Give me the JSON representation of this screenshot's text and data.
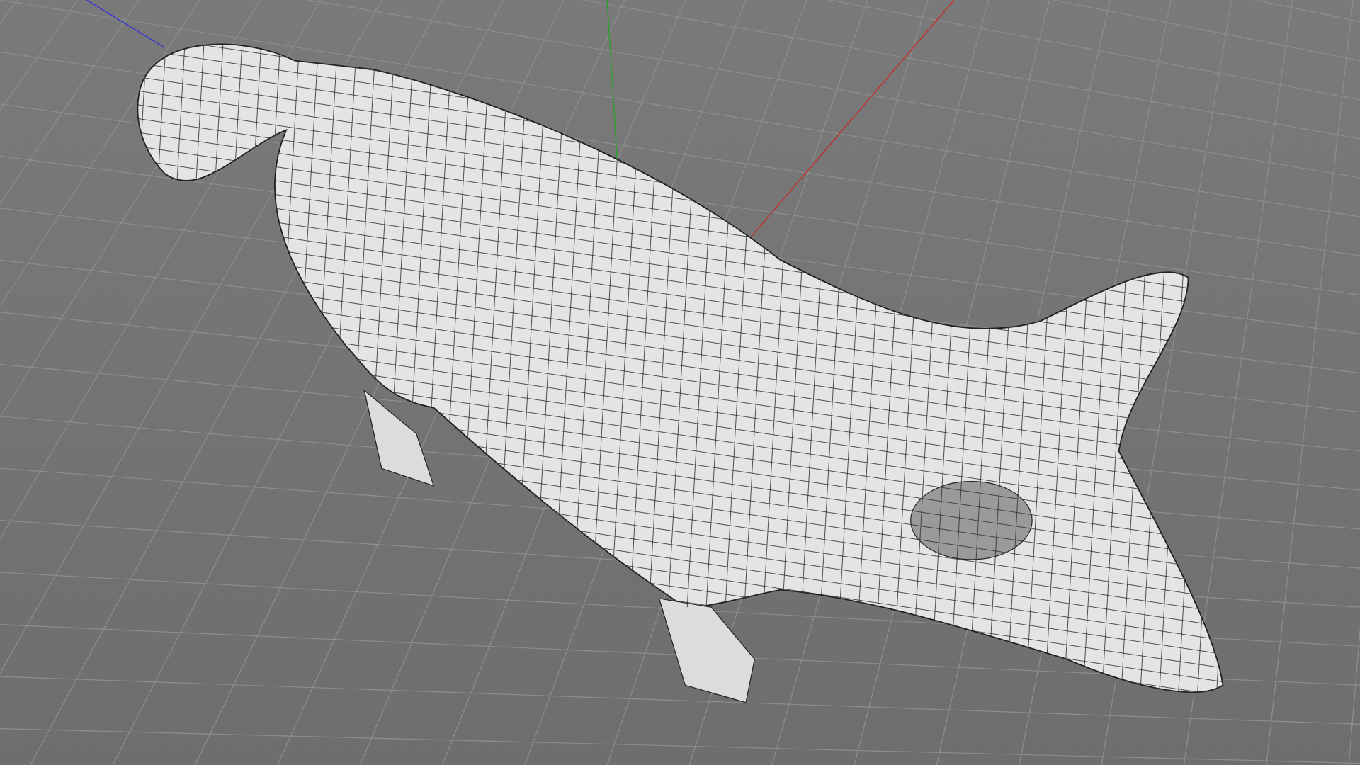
{
  "viewport": {
    "grid": true,
    "axes": true,
    "wireframe": true
  }
}
